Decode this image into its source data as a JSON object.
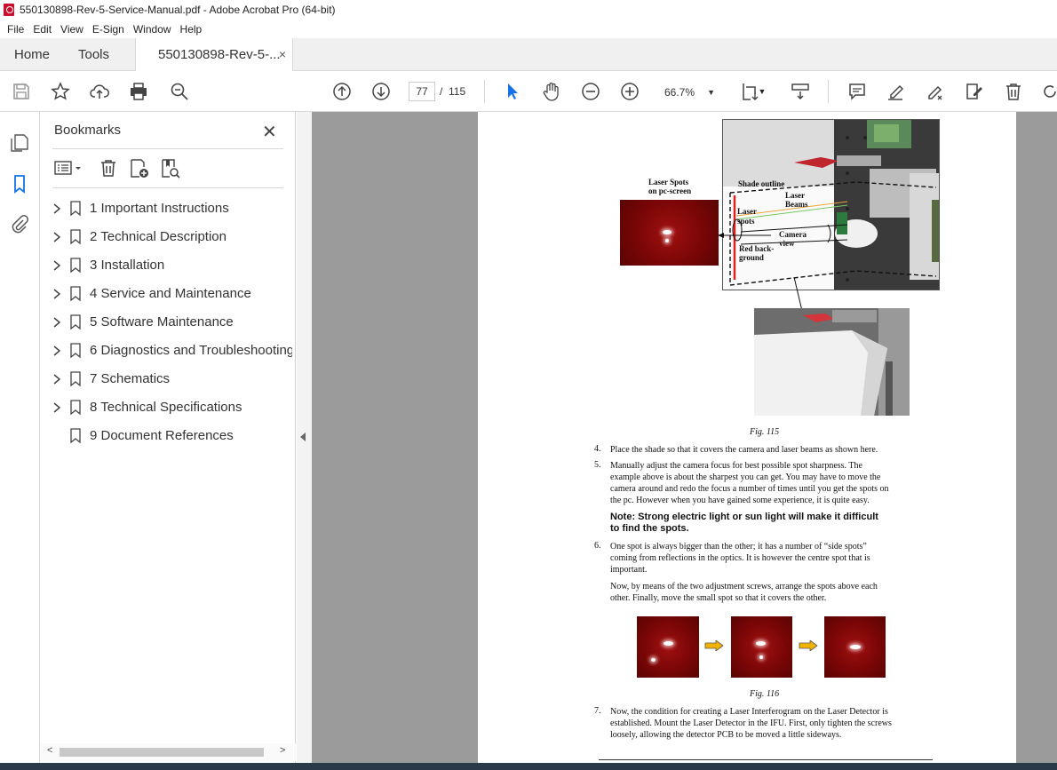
{
  "window": {
    "title": "550130898-Rev-5-Service-Manual.pdf - Adobe Acrobat Pro (64-bit)"
  },
  "menu": [
    "File",
    "Edit",
    "View",
    "E-Sign",
    "Window",
    "Help"
  ],
  "tabs": {
    "home": "Home",
    "tools": "Tools",
    "doc": "550130898-Rev-5-...",
    "close": "×"
  },
  "toolbar": {
    "page_current": "77",
    "page_sep": "/",
    "page_total": "115",
    "zoom": "66.7%"
  },
  "bookmarks": {
    "title": "Bookmarks",
    "items": [
      {
        "label": "1 Important Instructions",
        "expandable": true
      },
      {
        "label": "2 Technical Description",
        "expandable": true
      },
      {
        "label": "3 Installation",
        "expandable": true
      },
      {
        "label": "4 Service and Maintenance",
        "expandable": true
      },
      {
        "label": "5 Software Maintenance",
        "expandable": true
      },
      {
        "label": "6 Diagnostics and Troubleshooting",
        "expandable": true
      },
      {
        "label": "7 Schematics",
        "expandable": true
      },
      {
        "label": "8 Technical Specifications",
        "expandable": true
      },
      {
        "label": "9 Document References",
        "expandable": false
      }
    ]
  },
  "doc": {
    "fig115_labels": {
      "laser_spots_pc": "Laser Spots",
      "laser_spots_pc2": "on pc-screen",
      "shade_outline": "Shade outline",
      "laser_beams": "Laser",
      "laser_beams2": "Beams",
      "laser_spots": "Laser",
      "laser_spots2": "spots",
      "camera_view": "Camera",
      "camera_view2": "view",
      "red_bg": "Red back-",
      "red_bg2": "ground"
    },
    "fig115": "Fig. 115",
    "step4_num": "4.",
    "step4": "Place the shade so that it covers the camera and laser beams as shown here.",
    "step5_num": "5.",
    "step5_l1": "Manually adjust the camera focus for best possible spot sharpness. The",
    "step5_l2": "example above is about the sharpest you can get. You may have to move the",
    "step5_l3": "camera around and redo the focus a number of times until you get the spots on",
    "step5_l4": "the pc. However when you have gained some experience, it is quite easy.",
    "note_l1": "Note: Strong electric light or sun light will make it difficult",
    "note_l2": "to find the spots.",
    "step6_num": "6.",
    "step6_l1": "One spot is always bigger than the other; it has a number of “side spots”",
    "step6_l2": "coming from reflections in the optics. It is however the centre spot that is",
    "step6_l3": "important.",
    "para_l1": "Now, by means of the two adjustment screws, arrange the spots above each",
    "para_l2": "other. Finally, move the small spot so that it covers the other.",
    "fig116": "Fig. 116",
    "step7_num": "7.",
    "step7_l1": "Now, the condition for creating a Laser Interferogram on the Laser Detector is",
    "step7_l2": "established. Mount the Laser Detector in the IFU. First, only tighten the screws",
    "step7_l3": "loosely, allowing the detector PCB to be moved a little sideways."
  }
}
